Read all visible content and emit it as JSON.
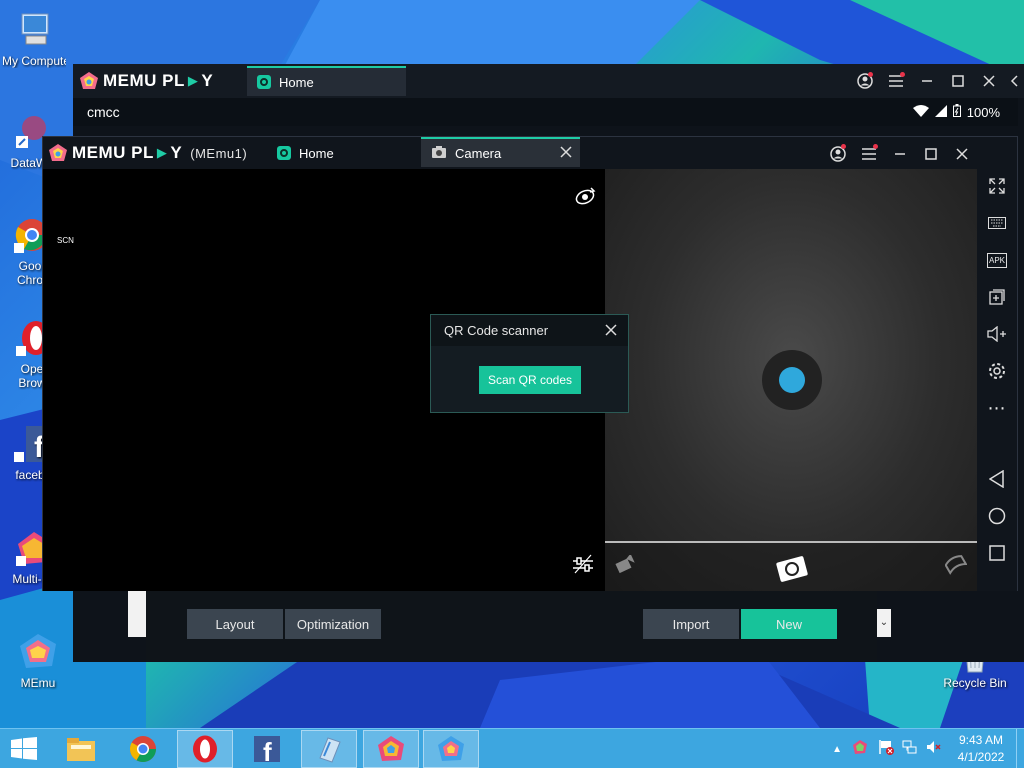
{
  "desktop": {
    "icons": [
      {
        "label": "My Computer",
        "icon": "computer-icon"
      },
      {
        "label": "DataWa",
        "icon": "datawa-icon"
      },
      {
        "label": "Goo Chro",
        "line1": "Goo",
        "line2": "Chro",
        "icon": "chrome-icon"
      },
      {
        "label": "Ope Brow",
        "line1": "Ope",
        "line2": "Brow",
        "icon": "opera-icon"
      },
      {
        "label": "faceb",
        "icon": "facebook-icon"
      },
      {
        "label": "Multi-M",
        "icon": "multi-memu-icon"
      },
      {
        "label": "MEmu",
        "icon": "memu-icon"
      },
      {
        "label": "Recycle Bin",
        "icon": "recycle-bin-icon"
      }
    ]
  },
  "outer_window": {
    "logo_text": "MEMU PL▶Y",
    "logo_a": "MEMU PL",
    "logo_b": "Y",
    "tab_label": "Home",
    "carrier": "cmcc",
    "battery": "100%",
    "bottom_buttons": {
      "layout": "Layout",
      "optimization": "Optimization",
      "import": "Import",
      "new": "New"
    }
  },
  "inner_window": {
    "logo_a": "MEMU PL",
    "logo_b": "Y",
    "instance": "(MEmu1)",
    "tabs": [
      {
        "label": "Home"
      },
      {
        "label": "Camera"
      }
    ],
    "scene_label": "SCN",
    "side_tools": [
      "collapse-icon",
      "fullscreen-icon",
      "keyboard-icon",
      "apk-icon",
      "add-window-icon",
      "volume-icon",
      "settings-icon",
      "more-icon",
      "back-icon",
      "home-icon",
      "recents-icon"
    ],
    "apk_label": "APK"
  },
  "dialog": {
    "title": "QR Code scanner",
    "button": "Scan QR codes"
  },
  "taskbar": {
    "time": "9:43 AM",
    "date": "4/1/2022"
  },
  "colors": {
    "accent": "#17c39a",
    "shutter": "#2fa8dc"
  }
}
